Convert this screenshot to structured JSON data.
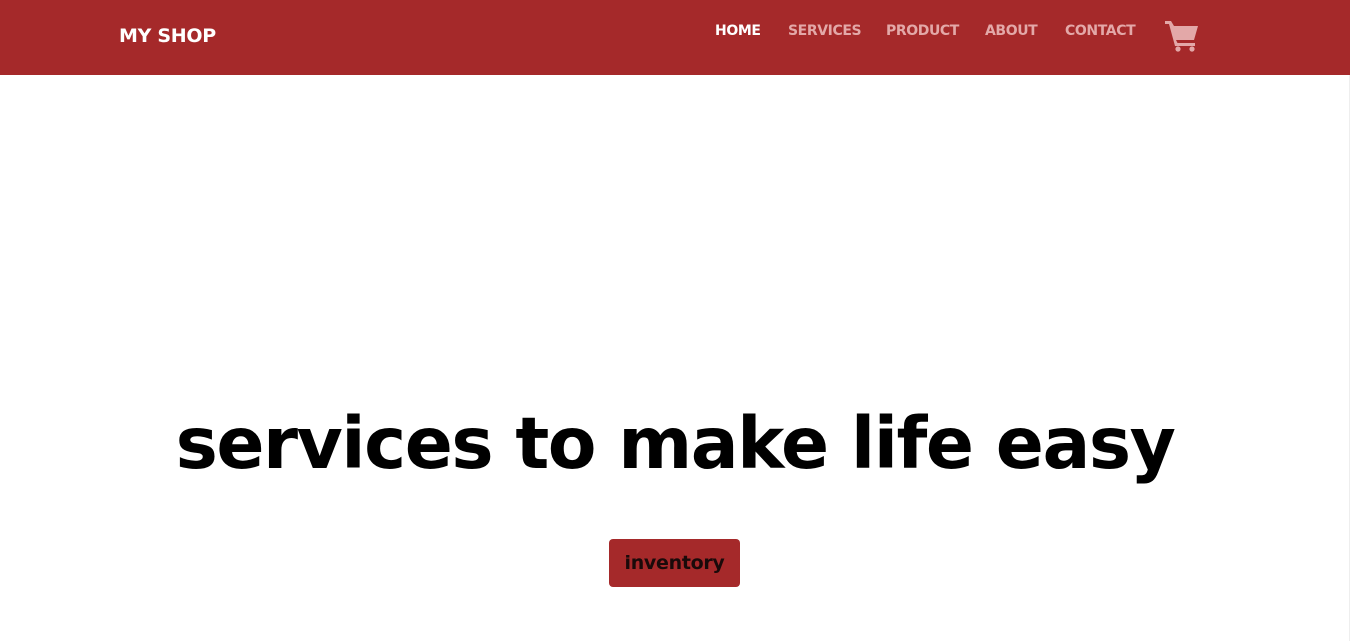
{
  "colors": {
    "navbar_bg": "#a5292a",
    "nav_active": "#ffffff",
    "nav_inactive": "#e3a8a8",
    "cart_icon": "#e3a8a8",
    "button_bg": "#a5292a"
  },
  "header": {
    "brand": "MY SHOP",
    "nav": [
      {
        "label": "HOME",
        "active": true
      },
      {
        "label": "SERVICES",
        "active": false
      },
      {
        "label": "PRODUCT",
        "active": false
      },
      {
        "label": "ABOUT",
        "active": false
      },
      {
        "label": "CONTACT",
        "active": false
      }
    ],
    "cart_icon": "shopping-cart-icon"
  },
  "hero": {
    "headline": "services to make life easy",
    "button_label": "inventory"
  }
}
